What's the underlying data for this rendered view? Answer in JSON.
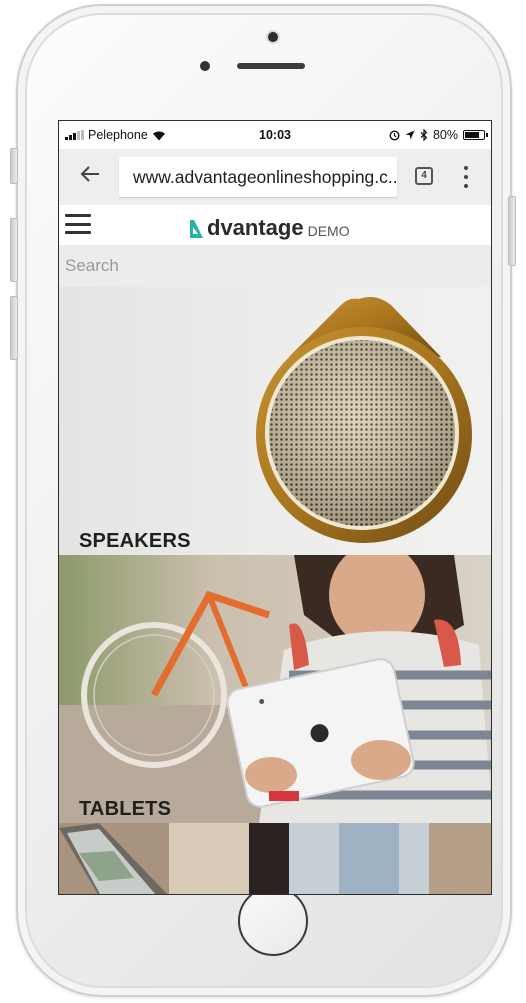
{
  "status_bar": {
    "carrier": "Pelephone",
    "time": "10:03",
    "battery_text": "80%",
    "battery_level": 0.8,
    "icons": [
      "signal-icon",
      "wifi-icon",
      "alarm-icon",
      "location-icon",
      "bluetooth-icon",
      "battery-icon"
    ]
  },
  "browser": {
    "url": "www.advantageonlineshopping.c...",
    "tab_count": "4",
    "back_icon": "back-arrow-icon",
    "menu_icon": "more-vert-icon"
  },
  "site": {
    "logo_word": "dvantage",
    "logo_suffix": "DEMO",
    "menu_icon": "hamburger-icon",
    "brand_color": "#26b3a7",
    "search_placeholder": "Search"
  },
  "categories": [
    {
      "label": "SPEAKERS"
    },
    {
      "label": "TABLETS"
    },
    {
      "label": ""
    }
  ]
}
